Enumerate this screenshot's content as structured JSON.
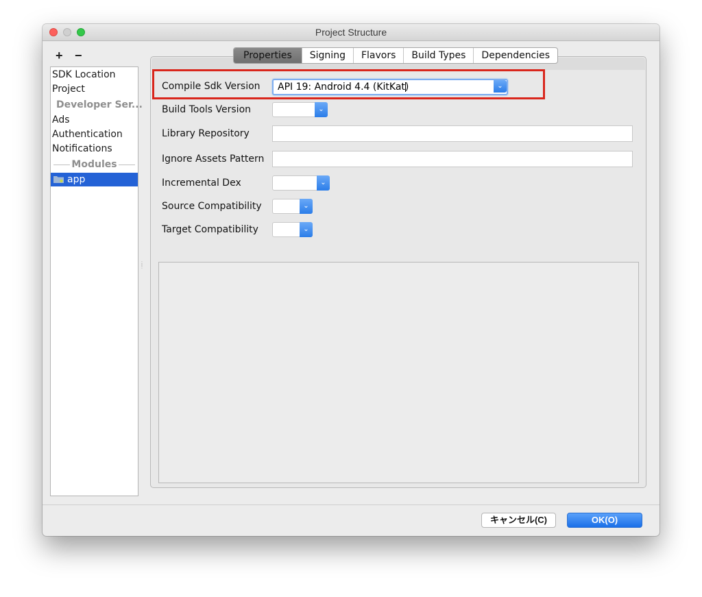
{
  "window": {
    "title": "Project Structure"
  },
  "toolbar": {
    "add": "+",
    "remove": "−"
  },
  "sidebar": {
    "items": [
      {
        "label": "SDK Location"
      },
      {
        "label": "Project"
      },
      {
        "label": "Developer Ser..."
      },
      {
        "label": "Ads"
      },
      {
        "label": "Authentication"
      },
      {
        "label": "Notifications"
      }
    ],
    "modules_header": "Modules",
    "selected_module": "app"
  },
  "tabs": [
    {
      "label": "Properties",
      "active": true
    },
    {
      "label": "Signing"
    },
    {
      "label": "Flavors"
    },
    {
      "label": "Build Types"
    },
    {
      "label": "Dependencies"
    }
  ],
  "form": {
    "compile_sdk": {
      "label": "Compile Sdk Version",
      "value": "API 19: Android 4.4 (KitKat)"
    },
    "build_tools": {
      "label": "Build Tools Version",
      "value": ""
    },
    "library_repo": {
      "label": "Library Repository",
      "value": ""
    },
    "ignore_assets": {
      "label": "Ignore Assets Pattern",
      "value": ""
    },
    "incremental_dex": {
      "label": "Incremental Dex",
      "value": ""
    },
    "source_compat": {
      "label": "Source Compatibility",
      "value": ""
    },
    "target_compat": {
      "label": "Target Compatibility",
      "value": ""
    }
  },
  "buttons": {
    "cancel": "キャンセル(C)",
    "ok": "OK(O)"
  },
  "colors": {
    "accent": "#2462d6",
    "highlight_box": "#d9261c",
    "ok_button": "#2b7de9"
  }
}
